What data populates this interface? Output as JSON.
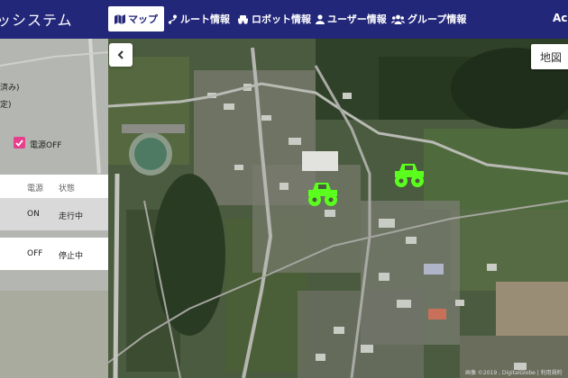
{
  "app": {
    "brand": "ッシステム"
  },
  "nav": {
    "items": [
      {
        "label": "マップ",
        "icon": "map-icon",
        "active": true
      },
      {
        "label": "ルート情報",
        "icon": "route-icon"
      },
      {
        "label": "ロボット情報",
        "icon": "robot-icon"
      },
      {
        "label": "ユーザー情報",
        "icon": "user-icon"
      },
      {
        "label": "グループ情報",
        "icon": "group-icon"
      }
    ],
    "user": "Acm"
  },
  "sidebar": {
    "line1": "済み)",
    "line2": "定)",
    "power_off_label": "電源OFF",
    "power_off_checked": true,
    "table": {
      "headers": [
        "電源",
        "状態"
      ],
      "rows": [
        {
          "power": "ON",
          "status": "走行中"
        },
        {
          "power": "OFF",
          "status": "停止中"
        }
      ]
    }
  },
  "map": {
    "type_button": "地図",
    "collapse_icon": "chevron-left-icon",
    "attribution": "画像 ©2019 , DigitalGlobe | 利用規約",
    "robots": [
      {
        "name": "robot-1",
        "color": "#5aff1e"
      },
      {
        "name": "robot-2",
        "color": "#5aff1e"
      }
    ]
  },
  "colors": {
    "navbar": "#23277a",
    "accent": "#e83e8c",
    "robot": "#5aff1e"
  }
}
